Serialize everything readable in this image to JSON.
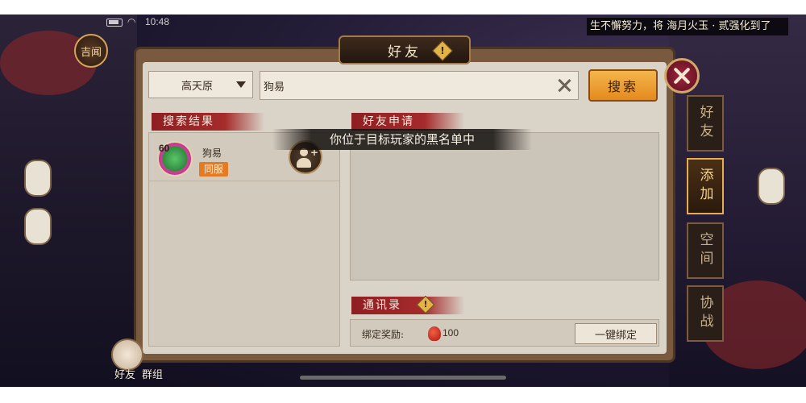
{
  "status_bar": {
    "time": "10:48"
  },
  "ticker": {
    "text": "生不懈努力，将 海月火玉 · 贰强化到了"
  },
  "left_hud": {
    "jixun_label": "吉闻"
  },
  "dialog": {
    "title": "好友",
    "title_icon": "warning-diamond-icon",
    "close_icon": "close-icon"
  },
  "search": {
    "region": "高天原",
    "query": "狗易",
    "button_label": "搜索"
  },
  "sections": {
    "results_title": "搜索结果",
    "requests_title": "好友申请",
    "contacts_title": "通讯录"
  },
  "result": {
    "level": "60",
    "name": "狗易",
    "server_tag": "同服"
  },
  "toast": {
    "text": "你位于目标玩家的黑名单中"
  },
  "contacts": {
    "bind_label": "绑定奖励:",
    "reward_value": "100",
    "bind_button": "一键绑定"
  },
  "side_tabs": [
    {
      "label": "好友",
      "active": false
    },
    {
      "label": "添加",
      "active": true
    },
    {
      "label": "空间",
      "active": false
    },
    {
      "label": "协战",
      "active": false
    }
  ],
  "dock": {
    "friend_label": "好友",
    "group_label": "群组"
  },
  "colors": {
    "accent_orange": "#e48a1e",
    "banner_red": "#a52b2b",
    "panel_bg": "#d9d3c8",
    "tab_active_border": "#e8ad4e"
  }
}
